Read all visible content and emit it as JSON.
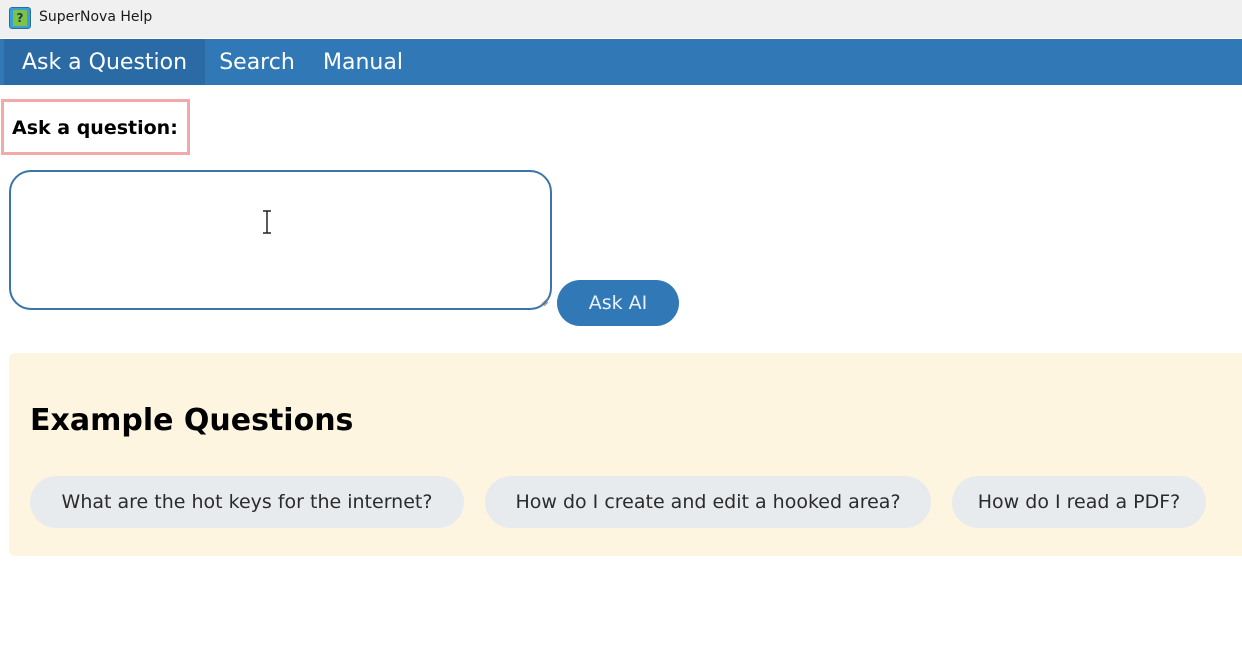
{
  "window": {
    "title": "SuperNova Help",
    "icon": "help-question-icon"
  },
  "nav": {
    "tabs": [
      {
        "label": "Ask a Question",
        "active": true
      },
      {
        "label": "Search",
        "active": false
      },
      {
        "label": "Manual",
        "active": false
      }
    ],
    "color": "#3178b6"
  },
  "ask": {
    "label": "Ask a question:",
    "input_value": "",
    "button_label": "Ask AI"
  },
  "examples": {
    "title": "Example Questions",
    "items": [
      "What are the hot keys for the internet?",
      "How do I create and edit a hooked area?",
      "How do I read a PDF?"
    ],
    "panel_color": "#fdf5df"
  }
}
